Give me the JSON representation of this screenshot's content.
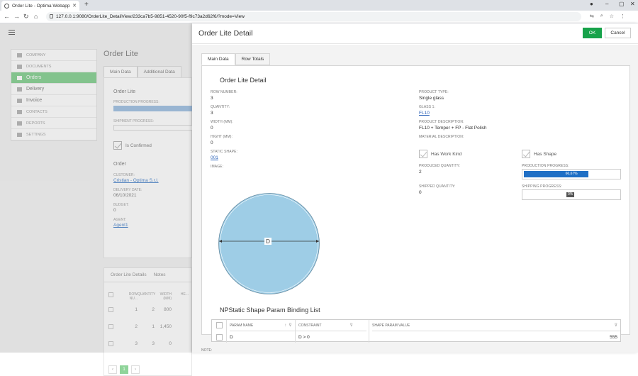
{
  "browser": {
    "tab_title": "Order Lite - Optima Webapp",
    "url": "127.0.0.1:9080/OrderLite_DetailView/233ca7b5-9851-4520-90f5-f9c73a2d62f6/?mode=View"
  },
  "background": {
    "sidebar": [
      {
        "label": "COMPANY",
        "active": false
      },
      {
        "label": "DOCUMENTS",
        "active": false
      },
      {
        "label": "Orders",
        "active": true
      },
      {
        "label": "Delivery",
        "active": false
      },
      {
        "label": "Invoice",
        "active": false
      },
      {
        "label": "CONTACTS",
        "active": false
      },
      {
        "label": "REPORTS",
        "active": false
      },
      {
        "label": "SETTINGS",
        "active": false
      }
    ],
    "title": "Order Lite",
    "tabs": [
      "Main Data",
      "Additional Data"
    ],
    "panel": {
      "section": "Order Lite",
      "production_progress_label": "PRODUCTION PROGRESS:",
      "shipment_progress_label": "SHIPMENT PROGRESS:",
      "is_confirmed": "Is Confirmed",
      "order_label": "Order",
      "customer_label": "CUSTOMER:",
      "customer_value": "Cristian - Optima S.r.l.",
      "delivery_date_label": "DELIVERY DATE:",
      "delivery_date_value": "06/10/2021",
      "budget_label": "BUDGET:",
      "budget_value": "0",
      "agent_label": "AGENT:",
      "agent_value": "Agent1"
    },
    "grid_tabs": [
      "Order Lite Details",
      "Notes"
    ],
    "grid_headers": [
      "ROW NU...",
      "QUANTITY",
      "WIDTH (MM)",
      "HE..."
    ],
    "grid_rows": [
      {
        "row": "1",
        "qty": "2",
        "width": "800"
      },
      {
        "row": "2",
        "qty": "1",
        "width": "1,450"
      },
      {
        "row": "3",
        "qty": "3",
        "width": "0"
      }
    ],
    "pager_current": "1"
  },
  "detail": {
    "title": "Order Lite Detail",
    "ok_label": "OK",
    "cancel_label": "Cancel",
    "tabs": [
      "Main Data",
      "Row Totals"
    ],
    "section_title": "Order Lite Detail",
    "row_number_label": "ROW NUMBER:",
    "row_number": "3",
    "quantity_label": "QUANTITY:",
    "quantity": "3",
    "width_label": "WIDTH (MM):",
    "width": "0",
    "height_label": "HIGHT (MM):",
    "height": "0",
    "static_shape_label": "STATIC SHAPE:",
    "static_shape": "001",
    "image_label": "IMAGE:",
    "shape_dim_label": "D",
    "product_type_label": "PRODUCT TYPE:",
    "product_type": "Single glass",
    "glass_label": "GLASS 1:",
    "glass": "FL10",
    "product_description_label": "PRODUCT DESCRIPTION:",
    "product_description": "FL10 + Temper + FP - Flat Polish",
    "material_description_label": "MATERIAL DESCRIPTION:",
    "has_work_kind": "Has Work Kind",
    "has_shape": "Has Shape",
    "produced_quantity_label": "PRODUCED QUANTITY:",
    "produced_quantity": "2",
    "shipped_quantity_label": "SHIPPED QUANTITY:",
    "shipped_quantity": "0",
    "production_progress_label": "PRODUCTION PROGRESS:",
    "production_progress_text": "66,67%",
    "production_progress": 0.6667,
    "shipping_progress_label": "SHIPPING PROGRESS:",
    "shipping_progress_text": "0%",
    "shipping_progress": 0,
    "list_title": "NPStatic Shape Param Binding List",
    "list_headers": [
      "PARAM NAME",
      "CONSTRAINT",
      "SHAPE PARAM VALUE"
    ],
    "list_rows": [
      {
        "param": "D",
        "constraint": "D > 0",
        "value": "555"
      }
    ],
    "note_label": "NOTE:"
  },
  "colors": {
    "ok": "#17a24a",
    "active_nav": "#8fd49a",
    "progress": "#1f6fc5",
    "shape_fill": "#9ecde6"
  }
}
